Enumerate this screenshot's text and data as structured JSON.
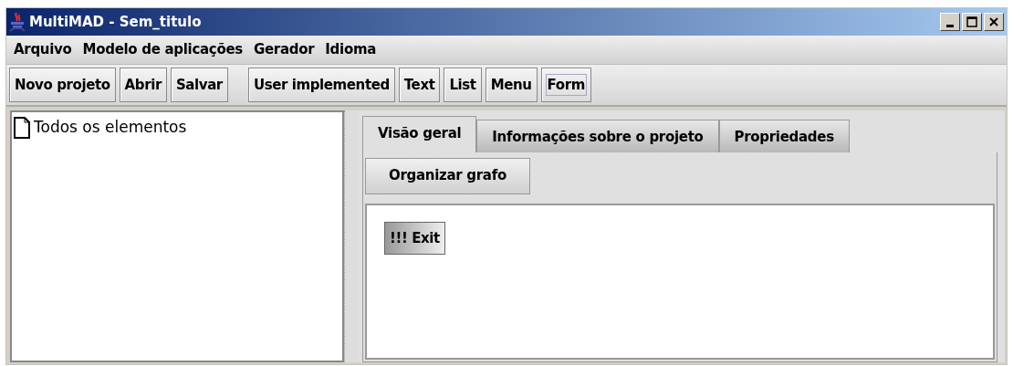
{
  "window": {
    "title": "MultiMAD - Sem_titulo"
  },
  "menu": [
    "Arquivo",
    "Modelo de aplicações",
    "Gerador",
    "Idioma"
  ],
  "toolbar": [
    {
      "buttons": [
        {
          "label": "Novo projeto",
          "focused": false
        },
        {
          "label": "Abrir",
          "focused": false
        },
        {
          "label": "Salvar",
          "focused": false
        }
      ]
    },
    {
      "buttons": [
        {
          "label": "User implemented",
          "focused": false
        },
        {
          "label": "Text",
          "focused": false
        },
        {
          "label": "List",
          "focused": false
        },
        {
          "label": "Menu",
          "focused": false
        },
        {
          "label": "Form",
          "focused": true
        }
      ]
    }
  ],
  "tree": {
    "items": [
      {
        "label": "Todos os elementos"
      }
    ]
  },
  "tabs": [
    {
      "label": "Visão geral",
      "selected": true
    },
    {
      "label": "Informações sobre o projeto",
      "selected": false
    },
    {
      "label": "Propriedades",
      "selected": false
    }
  ],
  "overview": {
    "button": "Organizar grafo",
    "nodes": [
      {
        "label": "!!! Exit"
      }
    ]
  }
}
